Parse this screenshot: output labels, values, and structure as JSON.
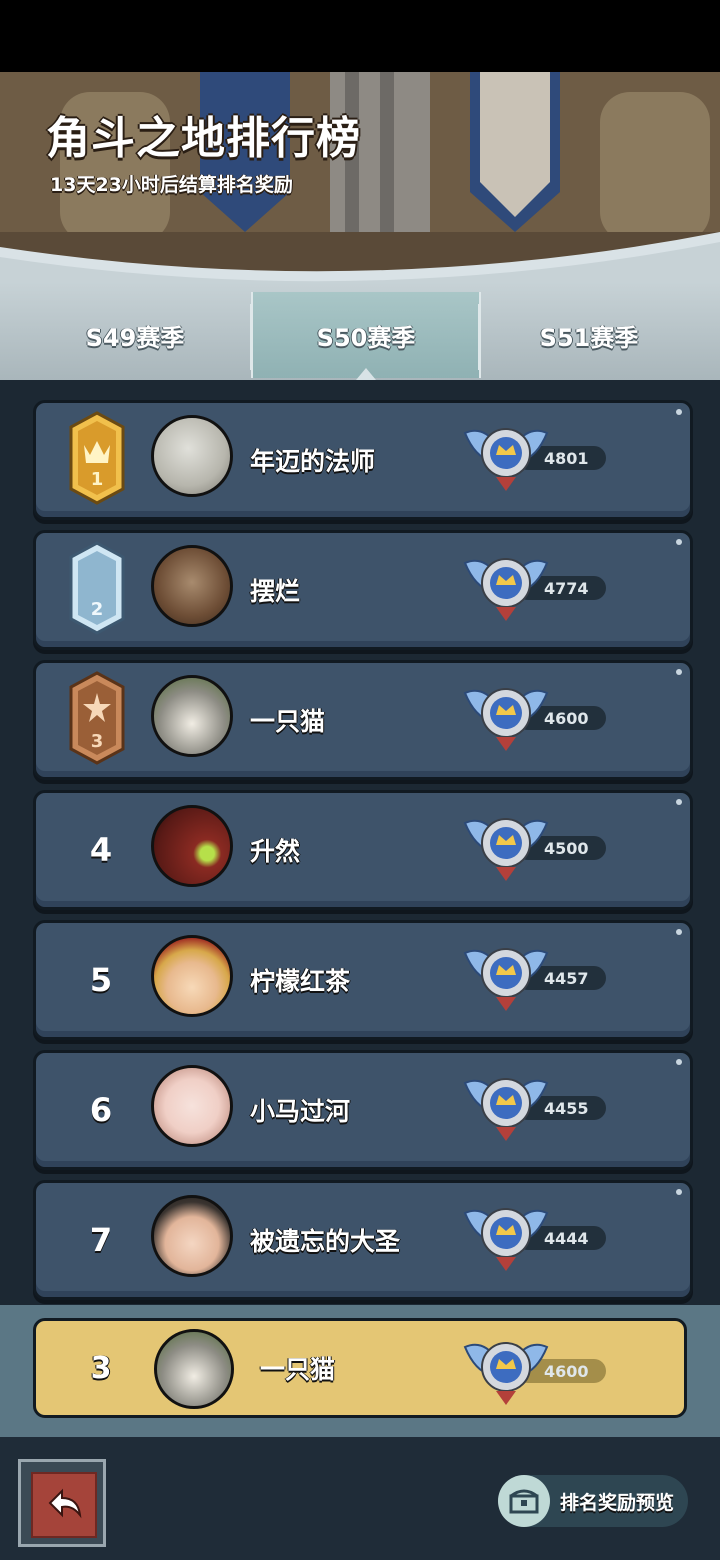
{
  "header": {
    "title": "角斗之地排行榜",
    "subtitle": "13天23小时后结算排名奖励"
  },
  "tabs": [
    {
      "label": "S49赛季",
      "active": false
    },
    {
      "label": "S50赛季",
      "active": true
    },
    {
      "label": "S51赛季",
      "active": false
    }
  ],
  "leaderboard": [
    {
      "rank": "1",
      "name": "年迈的法师",
      "score": "4801",
      "badge": "gold-crown-badge"
    },
    {
      "rank": "2",
      "name": "摆烂",
      "score": "4774",
      "badge": "silver-moon-badge"
    },
    {
      "rank": "3",
      "name": "一只猫",
      "score": "4600",
      "badge": "bronze-star-badge"
    },
    {
      "rank": "4",
      "name": "升然",
      "score": "4500"
    },
    {
      "rank": "5",
      "name": "柠檬红茶",
      "score": "4457"
    },
    {
      "rank": "6",
      "name": "小马过河",
      "score": "4455"
    },
    {
      "rank": "7",
      "name": "被遗忘的大圣",
      "score": "4444"
    }
  ],
  "self": {
    "rank": "3",
    "name": "一只猫",
    "score": "4600"
  },
  "footer": {
    "preview_label": "排名奖励预览"
  },
  "colors": {
    "row_bg": "#3e536a",
    "self_row_bg": "#e4c674",
    "active_tab": "#8fb1b3"
  }
}
